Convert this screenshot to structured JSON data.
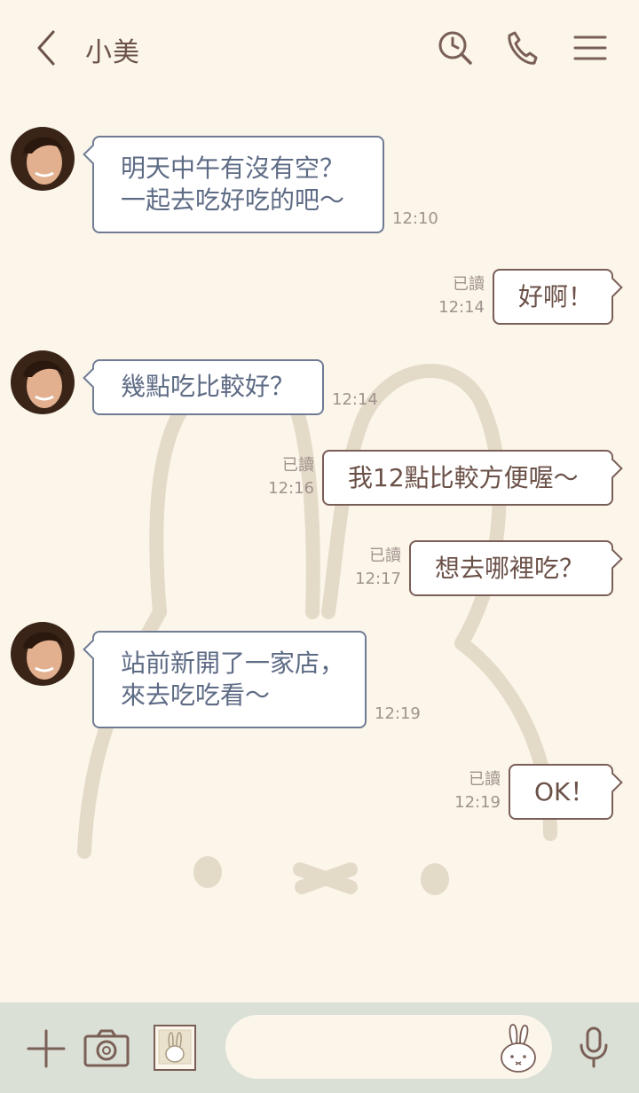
{
  "header": {
    "title": "小美",
    "icons": [
      "back-arrow-icon",
      "search-history-icon",
      "phone-icon",
      "menu-icon"
    ]
  },
  "messages": [
    {
      "side": "in",
      "text": "明天中午有沒有空？\n一起去吃好吃的吧〜",
      "time": "12:10"
    },
    {
      "side": "out",
      "text": "好啊！",
      "read": "已讀",
      "time": "12:14"
    },
    {
      "side": "in",
      "text": "幾點吃比較好？",
      "time": "12:14"
    },
    {
      "side": "out",
      "text": "我12點比較方便喔〜",
      "read": "已讀",
      "time": "12:16"
    },
    {
      "side": "out",
      "text": "想去哪裡吃？",
      "read": "已讀",
      "time": "12:17"
    },
    {
      "side": "in",
      "text": "站前新開了一家店，\n來去吃吃看〜",
      "time": "12:19"
    },
    {
      "side": "out",
      "text": "OK！",
      "read": "已讀",
      "time": "12:19"
    }
  ],
  "input_bar": {
    "value": "",
    "icons": [
      "plus-icon",
      "camera-icon",
      "sticker-icon",
      "bunny-emoji-icon",
      "microphone-icon"
    ]
  },
  "colors": {
    "background": "#fbf5ea",
    "bottom_bar": "#dae0d6",
    "incoming_border": "#6f7b93",
    "outgoing_border": "#7a5f57",
    "bunny_watermark": "#e4dac8"
  }
}
